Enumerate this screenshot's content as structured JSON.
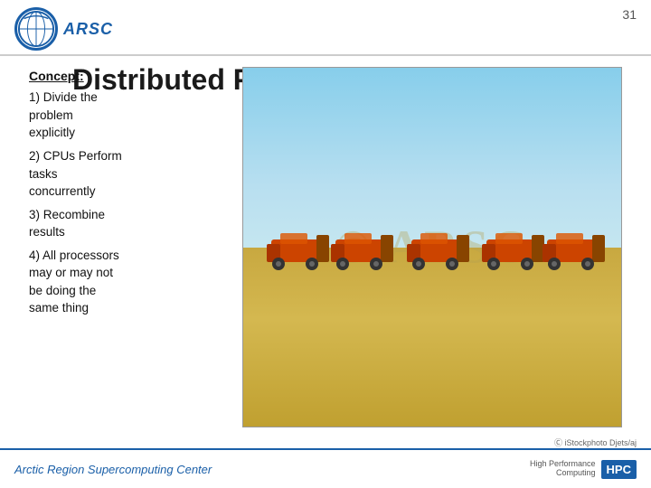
{
  "header": {
    "logo_text": "ARSC",
    "slide_number": "31"
  },
  "title": "Distributed Processing",
  "concept": {
    "label": "Concept:",
    "items": [
      {
        "number": "1)",
        "lines": [
          "Divide the",
          "problem",
          "explicitly"
        ]
      },
      {
        "number": "2)",
        "lines": [
          "CPUs Perform",
          "tasks",
          "concurrently"
        ]
      },
      {
        "number": "3)",
        "lines": [
          "Recombine",
          "results"
        ]
      },
      {
        "number": "4)",
        "lines": [
          "All processors",
          "may or may not",
          "be doing the",
          "same thing"
        ]
      }
    ]
  },
  "watermark": "© ARSC",
  "attribution": "Ⓒ iStockphoto Djets/aj",
  "footer": {
    "center_text": "Arctic Region Supercomputing Center",
    "hpc_label": "HPC"
  }
}
